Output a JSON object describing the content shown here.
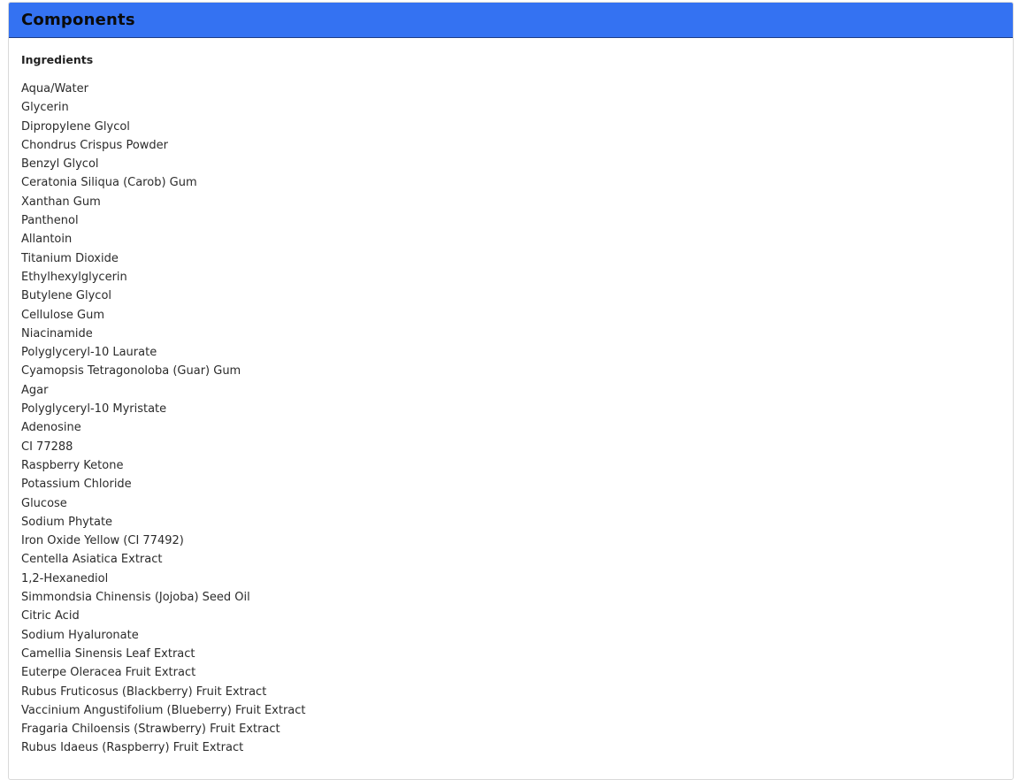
{
  "panel": {
    "title": "Components",
    "section_heading": "Ingredients",
    "ingredients": [
      "Aqua/Water",
      "Glycerin",
      "Dipropylene Glycol",
      "Chondrus Crispus Powder",
      "Benzyl Glycol",
      "Ceratonia Siliqua (Carob) Gum",
      "Xanthan Gum",
      "Panthenol",
      "Allantoin",
      "Titanium Dioxide",
      "Ethylhexylglycerin",
      "Butylene Glycol",
      "Cellulose Gum",
      "Niacinamide",
      "Polyglyceryl-10 Laurate",
      "Cyamopsis Tetragonoloba (Guar) Gum",
      "Agar",
      "Polyglyceryl-10 Myristate",
      "Adenosine",
      "CI 77288",
      "Raspberry Ketone",
      "Potassium Chloride",
      "Glucose",
      "Sodium Phytate",
      "Iron Oxide Yellow (CI 77492)",
      "Centella Asiatica Extract",
      "1,2-Hexanediol",
      "Simmondsia Chinensis (Jojoba) Seed Oil",
      "Citric Acid",
      "Sodium Hyaluronate",
      "Camellia Sinensis Leaf Extract",
      "Euterpe Oleracea Fruit Extract",
      "Rubus Fruticosus (Blackberry) Fruit Extract",
      "Vaccinium Angustifolium (Blueberry) Fruit Extract",
      "Fragaria Chiloensis (Strawberry) Fruit Extract",
      "Rubus Idaeus (Raspberry) Fruit Extract"
    ]
  },
  "colors": {
    "header_background": "#3472f2",
    "header_border": "#1f3d86",
    "title_text": "#0b0b0b",
    "body_text": "#2b2b2b"
  }
}
